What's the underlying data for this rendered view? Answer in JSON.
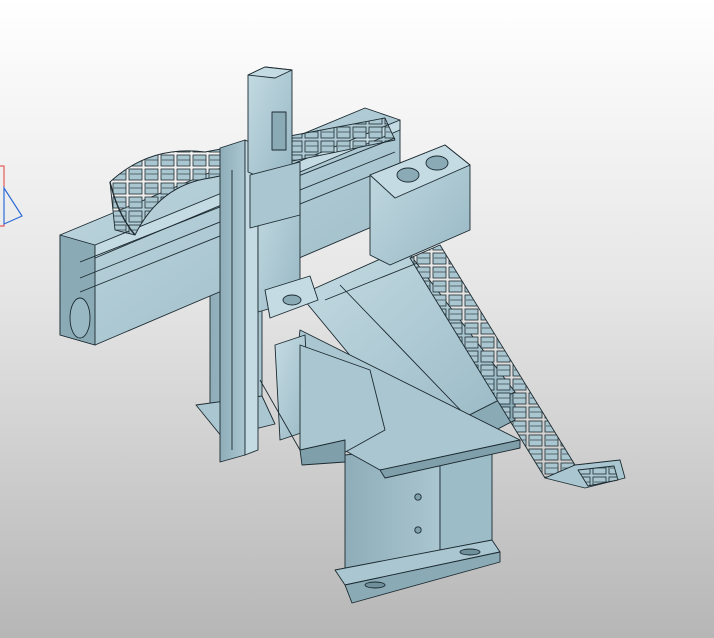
{
  "viewport": {
    "background_top": "#ffffff",
    "background_bottom": "#b6b6b6"
  },
  "model": {
    "body_color": "#aac6d0",
    "body_light": "#c4dbe3",
    "body_dark": "#7f9fab",
    "edge_color": "#1c2a30",
    "parts": [
      "horizontal-gantry-beam",
      "vertical-z-axis-slide",
      "servo-motor",
      "y-axis-base-module",
      "cable-drag-chain-top",
      "cable-drag-chain-right",
      "support-column-left",
      "support-column-center",
      "carriage-plate"
    ]
  },
  "triad": {
    "x_color": "#e23b3b",
    "y_color": "#2f6bd6",
    "z_color": "#2f6bd6"
  }
}
